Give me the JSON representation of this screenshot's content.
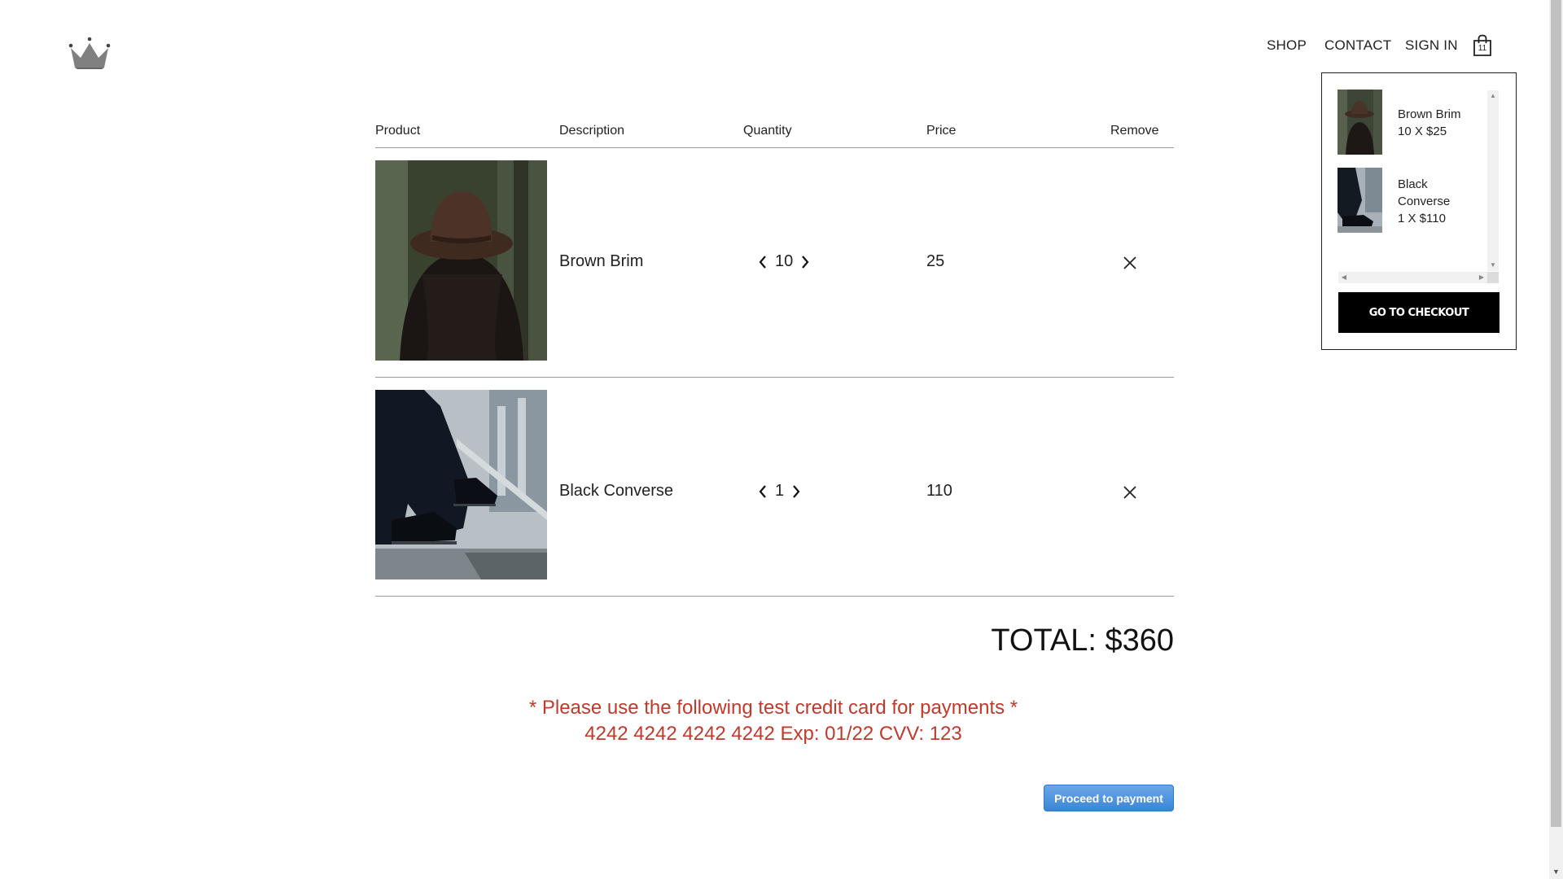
{
  "nav": {
    "shop": "SHOP",
    "contact": "CONTACT",
    "sign_in": "SIGN IN",
    "cart_count": "11"
  },
  "dropdown": {
    "items": [
      {
        "name": "Brown Brim",
        "qty_price": "10 X $25"
      },
      {
        "name": "Black Converse",
        "qty_price": "1 X $110"
      }
    ],
    "checkout_label": "GO TO CHECKOUT"
  },
  "table": {
    "headers": {
      "product": "Product",
      "description": "Description",
      "quantity": "Quantity",
      "price": "Price",
      "remove": "Remove"
    },
    "rows": [
      {
        "description": "Brown Brim",
        "quantity": "10",
        "price": "25"
      },
      {
        "description": "Black Converse",
        "quantity": "1",
        "price": "110"
      }
    ]
  },
  "total": "TOTAL: $360",
  "notice": {
    "line1": "* Please use the following test credit card for payments *",
    "line2": "4242 4242 4242 4242 Exp: 01/22 CVV: 123"
  },
  "payment_button": "Proceed to payment",
  "colors": {
    "notice": "#c0392b",
    "payment_button": "#3b86d6",
    "checkout_button": "#000000"
  }
}
